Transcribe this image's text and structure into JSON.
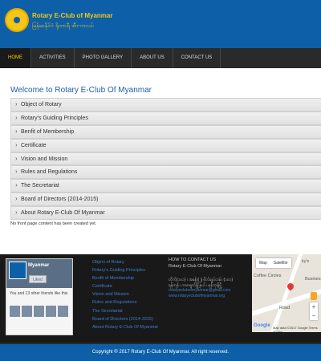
{
  "header": {
    "title": "Rotary E-Club of Myanmar",
    "subtitle": "မြန်မာနိုင်ငံ ရိုတာရီ အီး-ကလပ်"
  },
  "nav": {
    "items": [
      "HOME",
      "ACTIVITIES",
      "PHOTO GALLERY",
      "ABOUT US",
      "CONTACT US"
    ]
  },
  "main": {
    "title": "Welcome to Rotary E-Club Of Myanmar",
    "accordion": [
      "Object of Rotary",
      "Rotary's Guiding Principles",
      "Benfit of Membership",
      "Certificate",
      "Vision and Mission",
      "Rules and Regulations",
      "The Secretariat",
      "Board of Directors (2014-2015)",
      "About Rotary E-Club Of Myanmar"
    ],
    "no_content": "No front page content has been created yet."
  },
  "facebook": {
    "page_name": "Myanmar",
    "liked_label": "Liked",
    "friends_text": "You and 13 other friends like this"
  },
  "footer_links": [
    "Object of Rotary",
    "Rotary's Guiding Principles",
    "Benfit of Membership",
    "Certificate",
    "Vision and Mission",
    "Rules and Regulations",
    "The Secretariat",
    "Board of Directors (2014-2015)",
    "About Rotary E-Club Of Myanmar"
  ],
  "contact": {
    "title": "HOW TO CONTACT US",
    "name": "Rotary E-Club Of Myanmar",
    "address_1": "တိုက်(၁၀၁) ၊ အခန်း(၂) ဗိုလ်ချုပ်လမ်း (၁၀၁)",
    "address_2": "ရန်ကုန် ၊ ကမာရွတ်မြို့နယ် ၊ ရန်ကုန်မြို့",
    "email": "rotaryeclubofmyanmar@gmail.com",
    "website": "www.rotaryeclubofmyanmar.org"
  },
  "map": {
    "tab_map": "Map",
    "tab_satellite": "Satellite",
    "label_place": "Coffee Circles",
    "label_business": "Busines",
    "label_road": "Road",
    "label_ky": "ky's",
    "google": "Google",
    "attribution": "Map data ©2017 Google   Terms of Use"
  },
  "copyright": "Copyright ® 2017 Rotary E-Club Of Myanmar. All right reserved."
}
